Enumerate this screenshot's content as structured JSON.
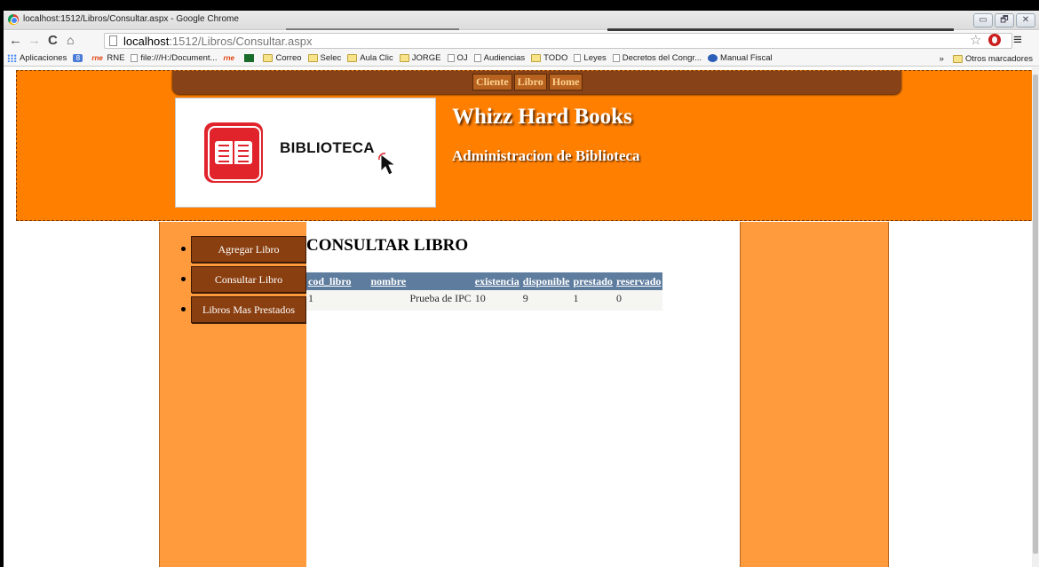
{
  "browser": {
    "window_title": "localhost:1512/Libros/Consultar.aspx - Google Chrome",
    "url_host": "localhost",
    "url_rest": ":1512/Libros/Consultar.aspx",
    "window_controls": [
      "▭",
      "🗗",
      "✕"
    ],
    "bookmarks": [
      {
        "label": "Aplicaciones",
        "icon": "apps-icon"
      },
      {
        "label": "",
        "icon": "google-icon"
      },
      {
        "label": "RNE",
        "icon": "rne-icon"
      },
      {
        "label": "file:///H:/Document...",
        "icon": "page-icon"
      },
      {
        "label": "",
        "icon": "rne-icon"
      },
      {
        "label": "",
        "icon": "rtve-icon"
      },
      {
        "label": "Correo",
        "icon": "folder-icon"
      },
      {
        "label": "Selec",
        "icon": "folder-icon"
      },
      {
        "label": "Aula Clic",
        "icon": "folder-icon"
      },
      {
        "label": "JORGE",
        "icon": "folder-icon"
      },
      {
        "label": "OJ",
        "icon": "page-icon"
      },
      {
        "label": "Audiencias",
        "icon": "page-icon"
      },
      {
        "label": "TODO",
        "icon": "folder-icon"
      },
      {
        "label": "Leyes",
        "icon": "page-icon"
      },
      {
        "label": "Decretos del Congr...",
        "icon": "page-icon"
      },
      {
        "label": "Manual Fiscal",
        "icon": "manual-icon"
      }
    ],
    "bookmarks_more": "»",
    "other_bookmarks": "Otros marcadores"
  },
  "site": {
    "top_nav": [
      "Cliente",
      "Libro",
      "Home"
    ],
    "logo_text": "BIBLIOTECA",
    "title": "Whizz Hard Books",
    "subtitle": "Administracion de Biblioteca"
  },
  "sidebar": {
    "items": [
      "Agregar Libro",
      "Consultar Libro",
      "Libros Mas Prestados"
    ]
  },
  "main": {
    "heading": "CONSULTAR LIBRO",
    "table": {
      "columns": [
        "cod_libro",
        "nombre",
        "existencia",
        "disponible",
        "prestado",
        "reservado"
      ],
      "rows": [
        [
          "1",
          "Prueba de IPC",
          "10",
          "9",
          "1",
          "0"
        ]
      ]
    }
  },
  "colors": {
    "header_orange": "#ff7f00",
    "column_orange": "#ff9a3d",
    "menu_brown": "#8a3f10",
    "table_header_blue": "#5e7c9e",
    "logo_red": "#e1242c"
  }
}
